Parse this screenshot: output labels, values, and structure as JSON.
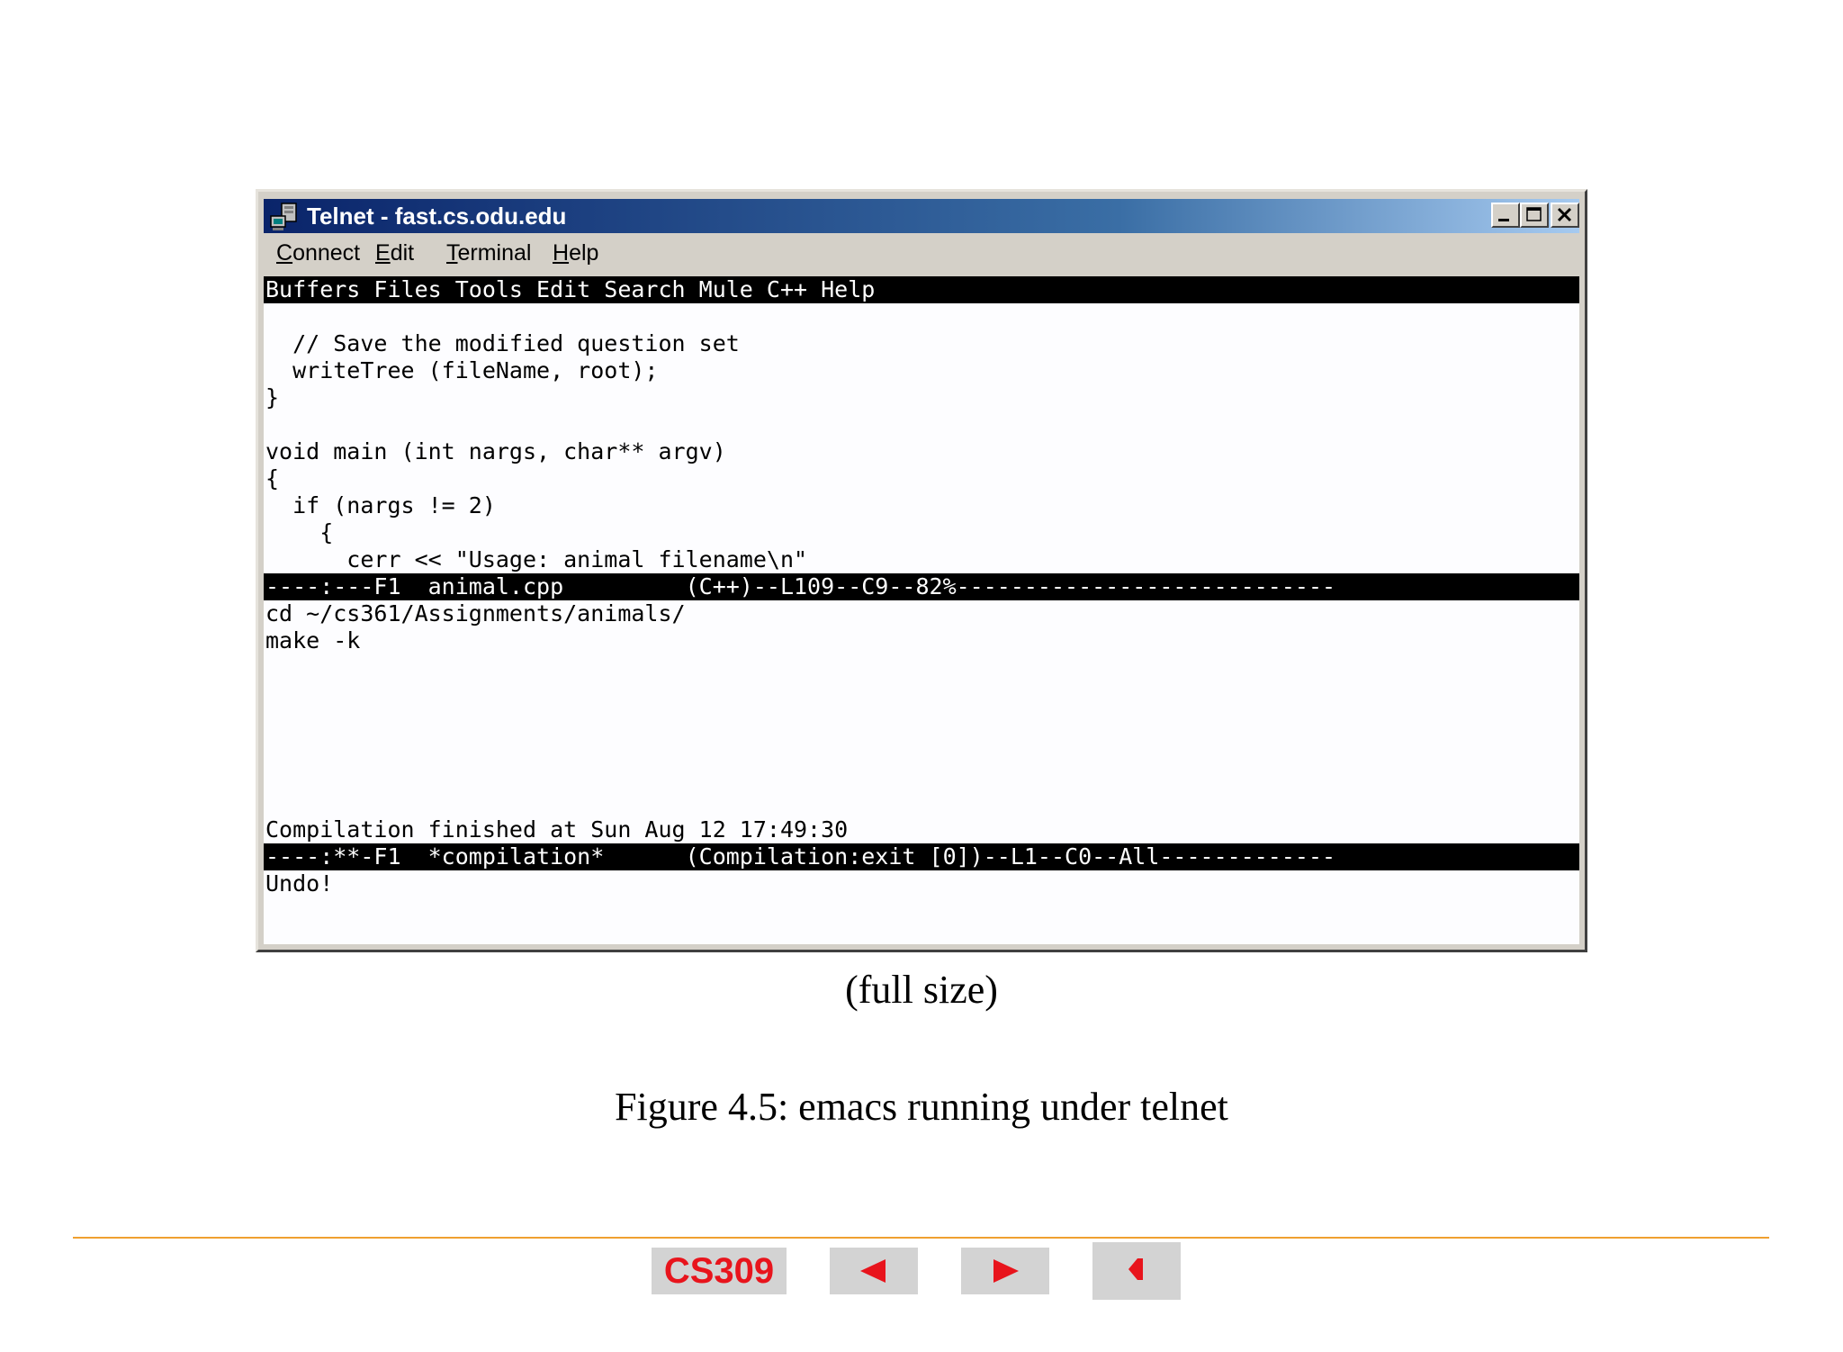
{
  "window": {
    "title": "Telnet - fast.cs.odu.edu",
    "icons": {
      "app": "telnet-computer-icon",
      "minimize": "minimize-icon",
      "maximize": "maximize-icon",
      "close": "close-icon"
    }
  },
  "menubar": {
    "connect": {
      "accel": "C",
      "rest": "onnect"
    },
    "edit": {
      "accel": "E",
      "rest": "dit"
    },
    "terminal": {
      "accel": "T",
      "rest": "erminal"
    },
    "help": {
      "accel": "H",
      "rest": "elp"
    }
  },
  "terminal": {
    "emacs_menu": "Buffers Files Tools Edit Search Mule C++ Help",
    "code_lines": [
      "",
      "  // Save the modified question set",
      "  writeTree (fileName, root);",
      "}",
      "",
      "void main (int nargs, char** argv)",
      "{",
      "  if (nargs != 2)",
      "    {",
      "      cerr << \"Usage: animal filename\\n\""
    ],
    "modeline_1": "----:---F1  animal.cpp         (C++)--L109--C9--82%----------------------------",
    "compile_lines": [
      "cd ~/cs361/Assignments/animals/",
      "make -k",
      "",
      "",
      "",
      "",
      "",
      "",
      "Compilation finished at Sun Aug 12 17:49:30"
    ],
    "modeline_2": "----:**-F1  *compilation*      (Compilation:exit [0])--L1--C0--All-------------",
    "minibuffer": "Undo!"
  },
  "caption_link": "(full size)",
  "figure_caption": "Figure 4.5: emacs running under telnet",
  "footer": {
    "course_label": "CS309",
    "prev_icon": "left-arrow-icon",
    "next_icon": "right-arrow-icon",
    "up_icon": "return-arrow-icon",
    "accent_color": "#e8141c",
    "divider_color": "#f0a030"
  }
}
